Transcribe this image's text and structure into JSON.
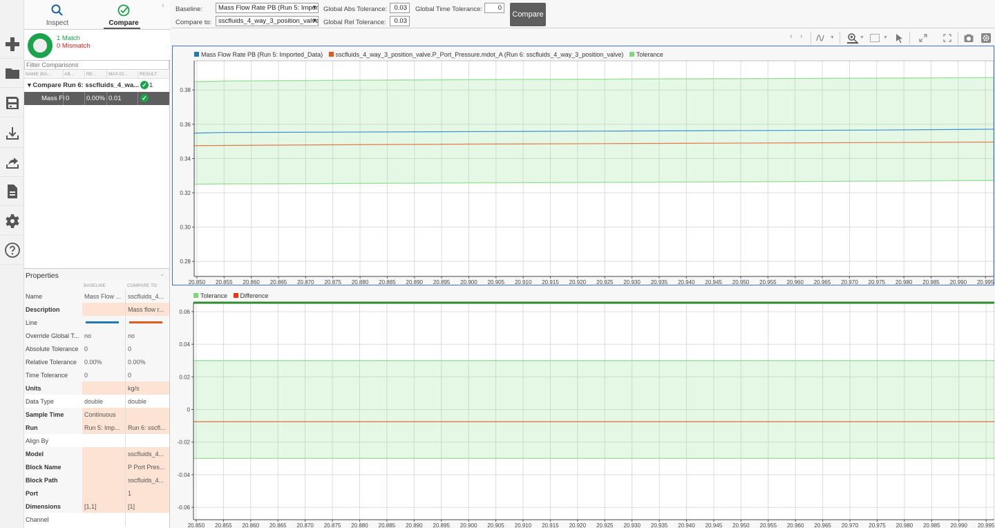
{
  "rail": {
    "items": [
      {
        "name": "new-icon"
      },
      {
        "name": "folder-icon"
      },
      {
        "name": "save-icon"
      },
      {
        "name": "import-icon"
      },
      {
        "name": "export-icon"
      },
      {
        "name": "report-icon"
      },
      {
        "name": "settings-icon"
      },
      {
        "name": "help-icon"
      }
    ]
  },
  "tabs": {
    "inspect": "Inspect",
    "compare": "Compare",
    "active": "compare"
  },
  "summary": {
    "match": "1 Match",
    "mismatch": "0 Mismatch",
    "match_color": "#1aa34a",
    "mismatch_color": "#e02020"
  },
  "filter": {
    "placeholder": "Filter Comparisons"
  },
  "table": {
    "columns": [
      "NAME (BA...",
      "AB...",
      "RE...",
      "MAX DI...",
      "RESULT"
    ],
    "group": {
      "label": "Compare Run 6: sscfluids_4_wa...",
      "result_count": "1",
      "result": "pass"
    },
    "rows": [
      {
        "name": "Mass Fl",
        "abs": "0",
        "rel": "0.00%",
        "max_diff": "0.01",
        "result": "pass"
      }
    ]
  },
  "properties": {
    "title": "Properties",
    "columns": {
      "baseline": "BASELINE",
      "compare_to": "COMPARE TO"
    },
    "rows": [
      {
        "key": "Name",
        "baseline": "Mass Flow ...",
        "compare": "sscfluids_4...",
        "bold": false,
        "diff": false
      },
      {
        "key": "Description",
        "baseline": "",
        "compare": "Mass flow r...",
        "bold": true,
        "diff": true
      },
      {
        "key": "Line",
        "baseline": "",
        "compare": "",
        "bold": false,
        "diff": false,
        "line": true
      },
      {
        "key": "Override Global T...",
        "baseline": "no",
        "compare": "no",
        "bold": false,
        "diff": false
      },
      {
        "key": "Absolute Tolerance",
        "baseline": "0",
        "compare": "0",
        "bold": false,
        "diff": false
      },
      {
        "key": "Relative Tolerance",
        "baseline": "0.00%",
        "compare": "0.00%",
        "bold": false,
        "diff": false
      },
      {
        "key": "Time Tolerance",
        "baseline": "0",
        "compare": "0",
        "bold": false,
        "diff": false
      },
      {
        "key": "Units",
        "baseline": "",
        "compare": "kg/s",
        "bold": true,
        "diff": true
      },
      {
        "key": "Data Type",
        "baseline": "double",
        "compare": "double",
        "bold": false,
        "diff": false,
        "white": true
      },
      {
        "key": "Sample Time",
        "baseline": "Continuous",
        "compare": "",
        "bold": true,
        "diff": true
      },
      {
        "key": "Run",
        "baseline": "Run 5: Imp...",
        "compare": "Run 6: sscfl...",
        "bold": true,
        "diff": true
      },
      {
        "key": "Align By",
        "baseline": "",
        "compare": "",
        "bold": false,
        "diff": false,
        "white": true
      },
      {
        "key": "Model",
        "baseline": "",
        "compare": "sscfluids_4...",
        "bold": true,
        "diff": true
      },
      {
        "key": "Block Name",
        "baseline": "",
        "compare": "P Port Pres...",
        "bold": true,
        "diff": true
      },
      {
        "key": "Block Path",
        "baseline": "",
        "compare": "sscfluids_4...",
        "bold": true,
        "diff": true
      },
      {
        "key": "Port",
        "baseline": "",
        "compare": "1",
        "bold": true,
        "diff": true
      },
      {
        "key": "Dimensions",
        "baseline": "[1,1]",
        "compare": "[1]",
        "bold": true,
        "diff": true
      },
      {
        "key": "Channel",
        "baseline": "",
        "compare": "",
        "bold": false,
        "diff": false,
        "white": true
      }
    ],
    "line_colors": {
      "baseline": "#1f77b4",
      "compare": "#e05a1e"
    }
  },
  "topbar": {
    "baseline_label": "Baseline:",
    "baseline_value": "Mass Flow Rate PB (Run 5: Impor",
    "compare_label": "Compare to:",
    "compare_value": "sscfluids_4_way_3_position_valve",
    "abs_tol_label": "Global Abs Tolerance:",
    "abs_tol": "0.03",
    "rel_tol_label": "Global Rel Tolerance:",
    "rel_tol": "0.03",
    "time_tol_label": "Global Time Tolerance:",
    "time_tol": "0",
    "compare_button": "Compare"
  },
  "toolbar": {
    "items": [
      "back-icon",
      "forward-icon",
      "signal-style-icon",
      "zoom-in-icon",
      "fit-icon",
      "cursor-icon",
      "expand-icon",
      "fullscreen-icon",
      "camera-icon",
      "plot-settings-icon"
    ]
  },
  "chart_data": [
    {
      "type": "line",
      "title": "",
      "legend": [
        {
          "name": "Mass Flow Rate PB (Run 5: Imported_Data)",
          "color": "#1f77b4"
        },
        {
          "name": "sscfluids_4_way_3_position_valve.P_Port_Pressure.mdot_A (Run 6: sscfluids_4_way_3_position_valve)",
          "color": "#e05a1e"
        },
        {
          "name": "Tolerance",
          "color": "#7fd67f"
        }
      ],
      "legend_position": "top-left",
      "xlim": [
        20.8495,
        20.9965
      ],
      "ylim": [
        0.2712,
        0.397
      ],
      "xticks": [
        "20.850",
        "20.855",
        "20.860",
        "20.865",
        "20.870",
        "20.875",
        "20.880",
        "20.885",
        "20.890",
        "20.895",
        "20.900",
        "20.905",
        "20.910",
        "20.915",
        "20.920",
        "20.925",
        "20.930",
        "20.935",
        "20.940",
        "20.945",
        "20.950",
        "20.955",
        "20.960",
        "20.965",
        "20.970",
        "20.975",
        "20.980",
        "20.985",
        "20.990",
        "20.995"
      ],
      "yticks": [
        "0.28",
        "0.30",
        "0.32",
        "0.34",
        "0.36",
        "0.38"
      ],
      "grid": true,
      "x": [
        20.8495,
        20.855,
        20.875,
        20.9,
        20.925,
        20.95,
        20.975,
        20.9965
      ],
      "series": [
        {
          "name": "Mass Flow Rate PB (Run 5: Imported_Data)",
          "values": [
            0.3548,
            0.3552,
            0.3554,
            0.3557,
            0.356,
            0.3563,
            0.3566,
            0.3571
          ]
        },
        {
          "name": "sscfluids_4_way_3_position_valve.P_Port_Pressure.mdot_A",
          "values": [
            0.3475,
            0.3476,
            0.348,
            0.3484,
            0.3487,
            0.349,
            0.3493,
            0.3496
          ]
        },
        {
          "name": "Tolerance upper",
          "values": [
            0.3848,
            0.3852,
            0.3856,
            0.386,
            0.3863,
            0.3866,
            0.3869,
            0.3872
          ]
        },
        {
          "name": "Tolerance lower",
          "values": [
            0.325,
            0.3252,
            0.3254,
            0.3258,
            0.3261,
            0.3264,
            0.3268,
            0.3272
          ]
        }
      ]
    },
    {
      "type": "line",
      "title": "",
      "legend": [
        {
          "name": "Tolerance",
          "color": "#7fd67f"
        },
        {
          "name": "Difference",
          "color": "#ee3311"
        }
      ],
      "legend_position": "top-left",
      "xlim": [
        20.8495,
        20.9965
      ],
      "ylim": [
        -0.0676,
        0.0655
      ],
      "xticks": [
        "20.850",
        "20.855",
        "20.860",
        "20.865",
        "20.870",
        "20.875",
        "20.880",
        "20.885",
        "20.890",
        "20.895",
        "20.900",
        "20.905",
        "20.910",
        "20.915",
        "20.920",
        "20.925",
        "20.930",
        "20.935",
        "20.940",
        "20.945",
        "20.950",
        "20.955",
        "20.960",
        "20.965",
        "20.970",
        "20.975",
        "20.980",
        "20.985",
        "20.990",
        "20.995"
      ],
      "yticks": [
        "-0.06",
        "-0.04",
        "-0.02",
        "0",
        "0.02",
        "0.04",
        "0.06"
      ],
      "grid": true,
      "x": [
        20.8495,
        20.9965
      ],
      "series": [
        {
          "name": "Tolerance upper",
          "values": [
            0.03,
            0.03
          ]
        },
        {
          "name": "Tolerance lower",
          "values": [
            -0.03,
            -0.03
          ]
        },
        {
          "name": "Difference",
          "values": [
            -0.0075,
            -0.0075
          ]
        },
        {
          "name": "Pass indicator",
          "values": [
            0.0655,
            0.0655
          ]
        }
      ]
    }
  ]
}
